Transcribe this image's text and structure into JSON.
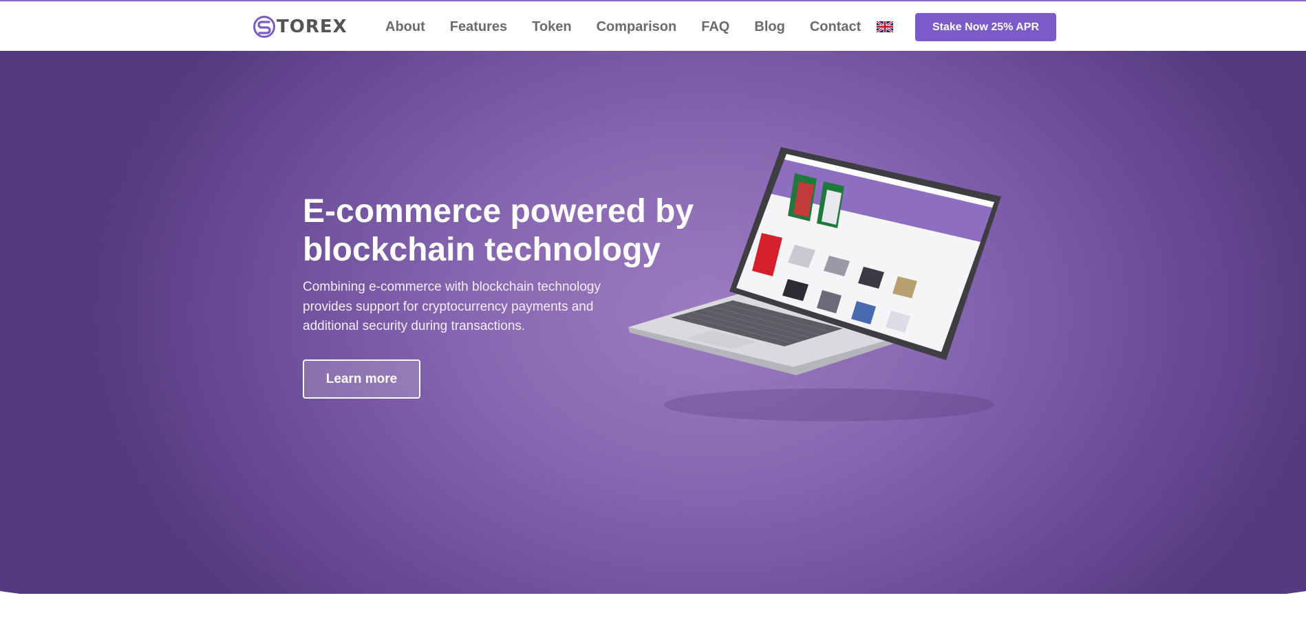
{
  "brand": {
    "name": "TOREX",
    "logo_icon": "storex-logo-icon",
    "accent_color": "#7b5bc9"
  },
  "nav": {
    "links": [
      "About",
      "Features",
      "Token",
      "Comparison",
      "FAQ",
      "Blog",
      "Contact"
    ],
    "language_icon": "uk-flag-icon",
    "cta_label": "Stake Now 25% APR"
  },
  "hero": {
    "title": "E-commerce powered by blockchain technology",
    "description": "Combining e-commerce with blockchain technology provides support for cryptocurrency payments and additional security during transactions.",
    "button_label": "Learn more",
    "image_icon": "laptop-storex-preview-image"
  },
  "colors": {
    "hero_purple": "#6e4f9a",
    "nav_text": "#6b6b6b",
    "button": "#7b5bc9"
  }
}
